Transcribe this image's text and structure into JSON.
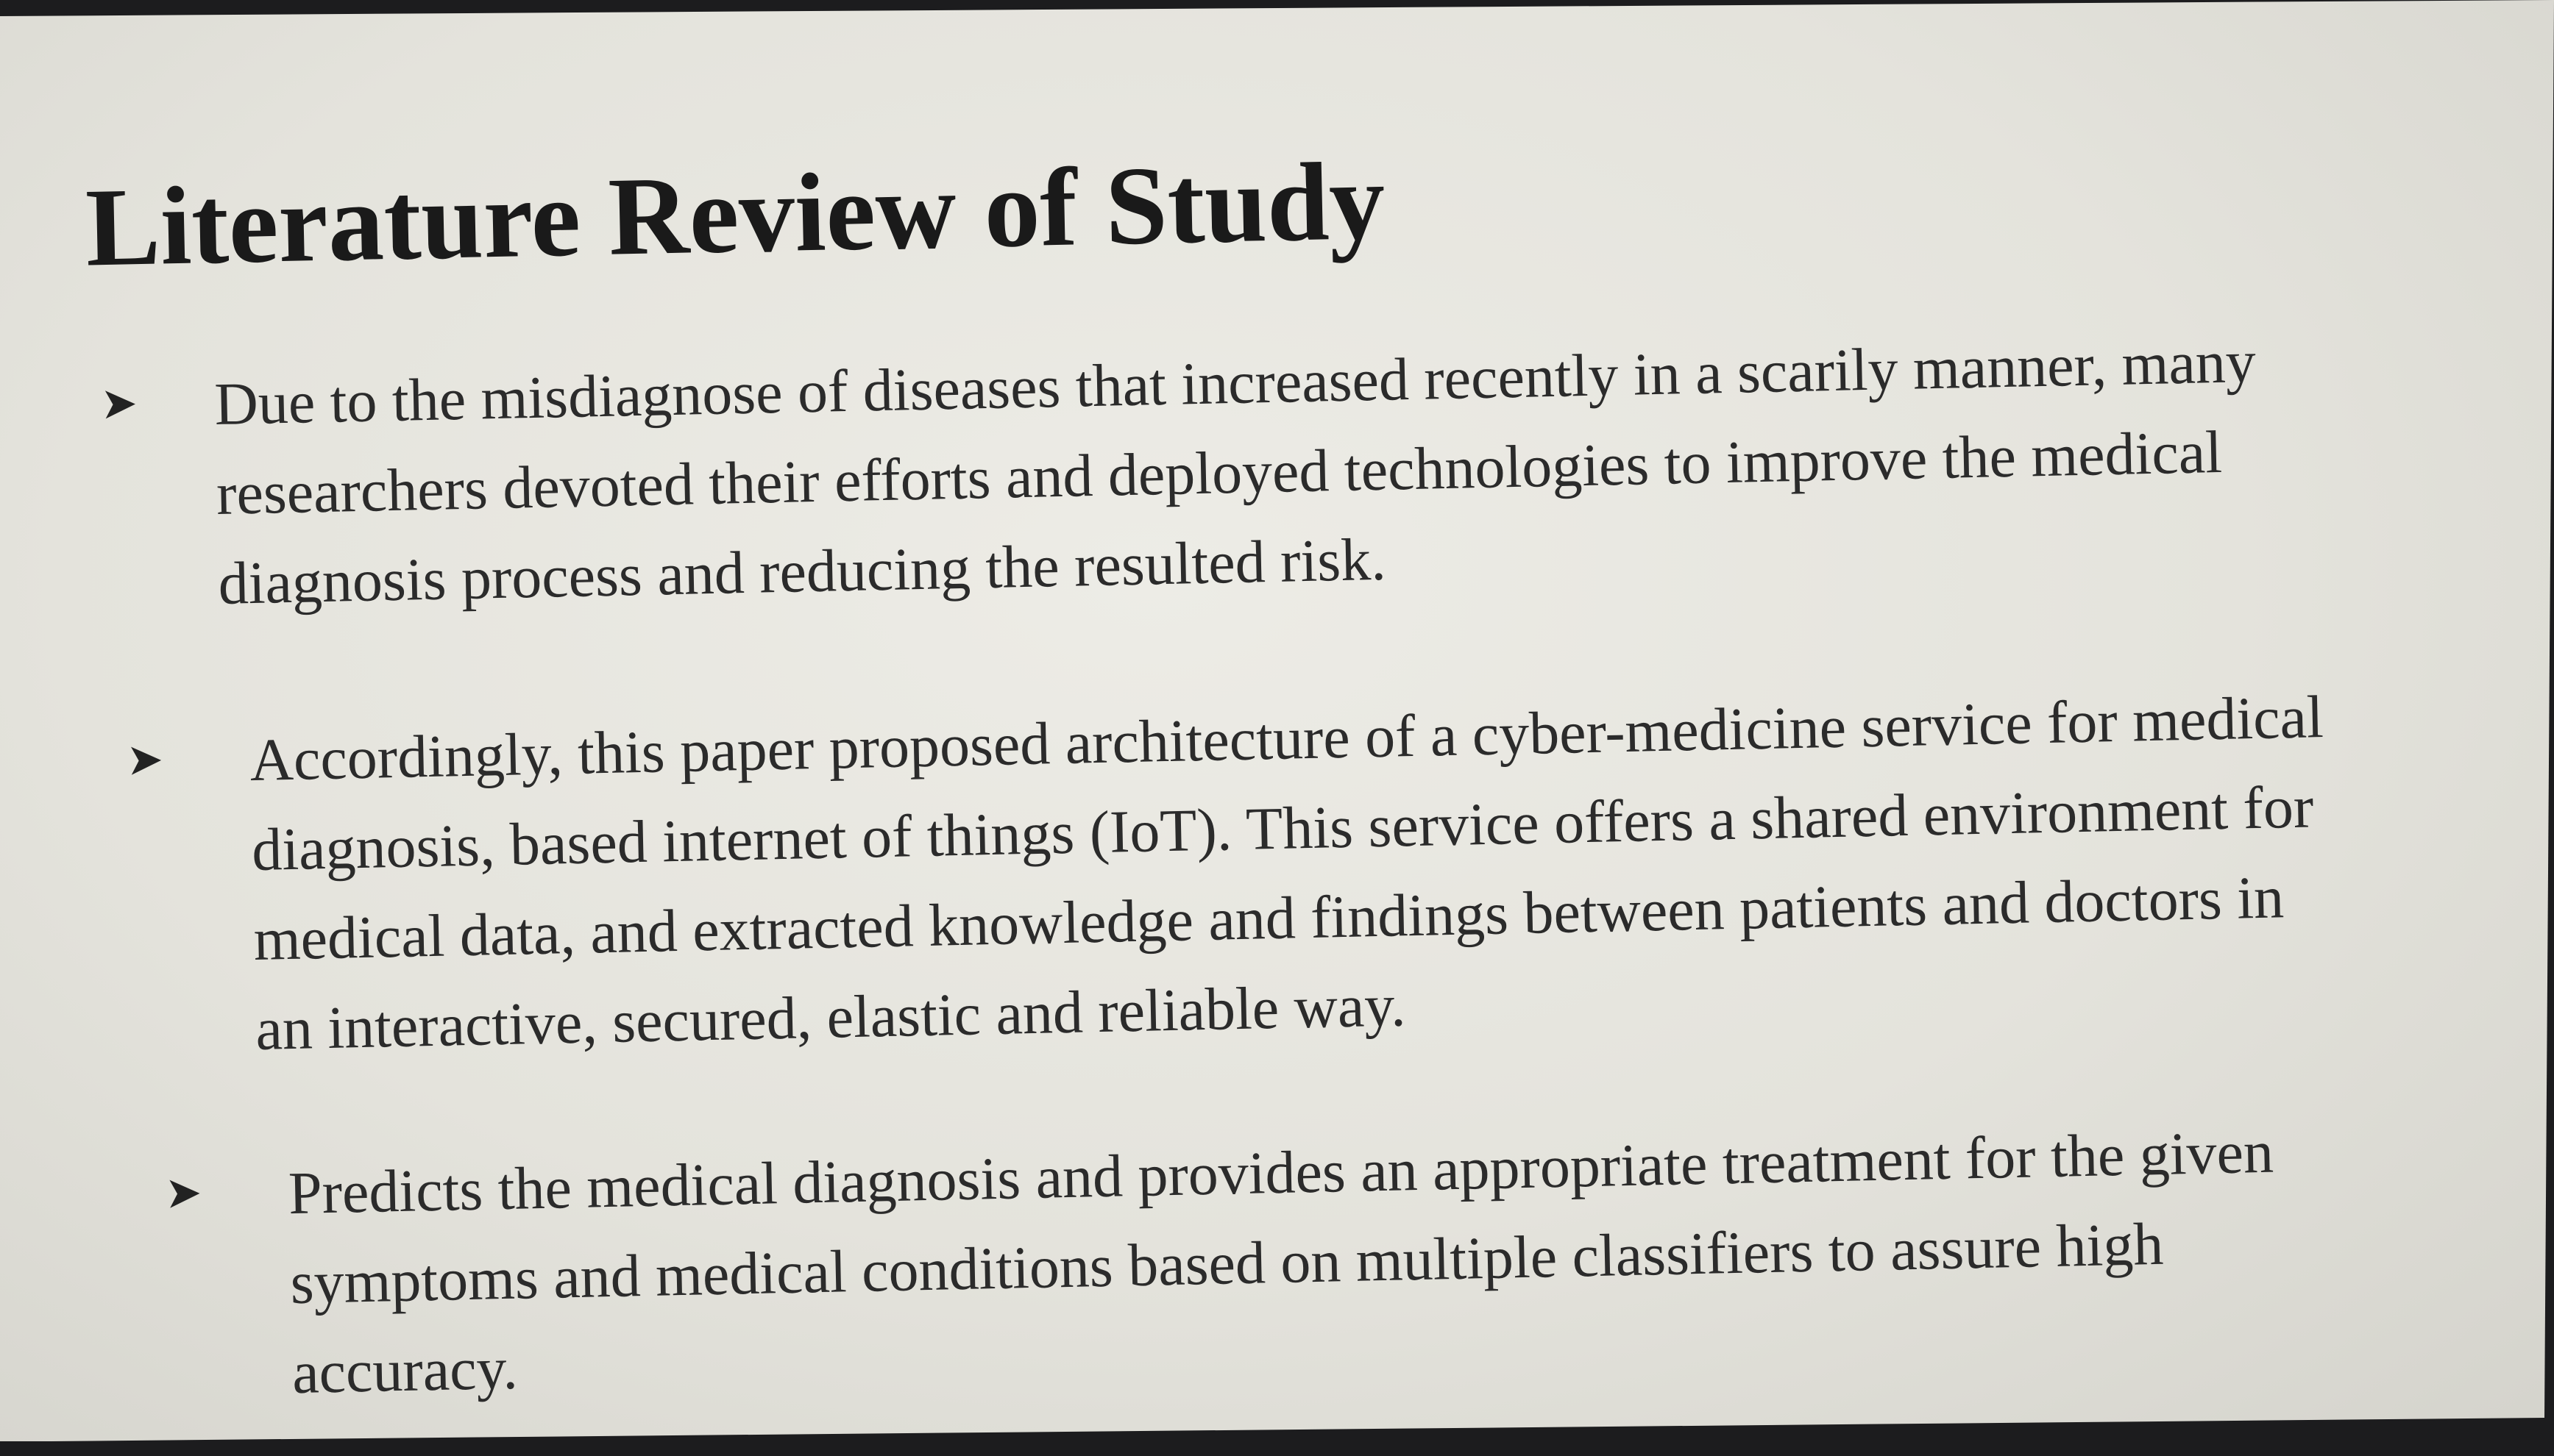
{
  "slide": {
    "title": "Literature Review of Study",
    "bullet_icon": "arrowhead-bullet-icon",
    "bullets": [
      {
        "lines": [
          "Due to the misdiagnose of diseases that increased recently in a scarily manner, many",
          "researchers devoted their efforts and deployed technologies to improve the medical",
          "diagnosis process and reducing the resulted risk."
        ]
      },
      {
        "lines": [
          "Accordingly, this paper proposed architecture of a cyber-medicine service for medical",
          "diagnosis, based internet of things (IoT). This service offers a shared environment for",
          "medical data, and extracted knowledge and findings between patients and doctors in",
          "an interactive, secured, elastic and reliable way."
        ]
      },
      {
        "lines": [
          "Predicts the medical diagnosis and provides an appropriate treatment for the given",
          "symptoms and medical conditions based on multiple classifiers to assure high",
          "accuracy."
        ]
      }
    ]
  }
}
